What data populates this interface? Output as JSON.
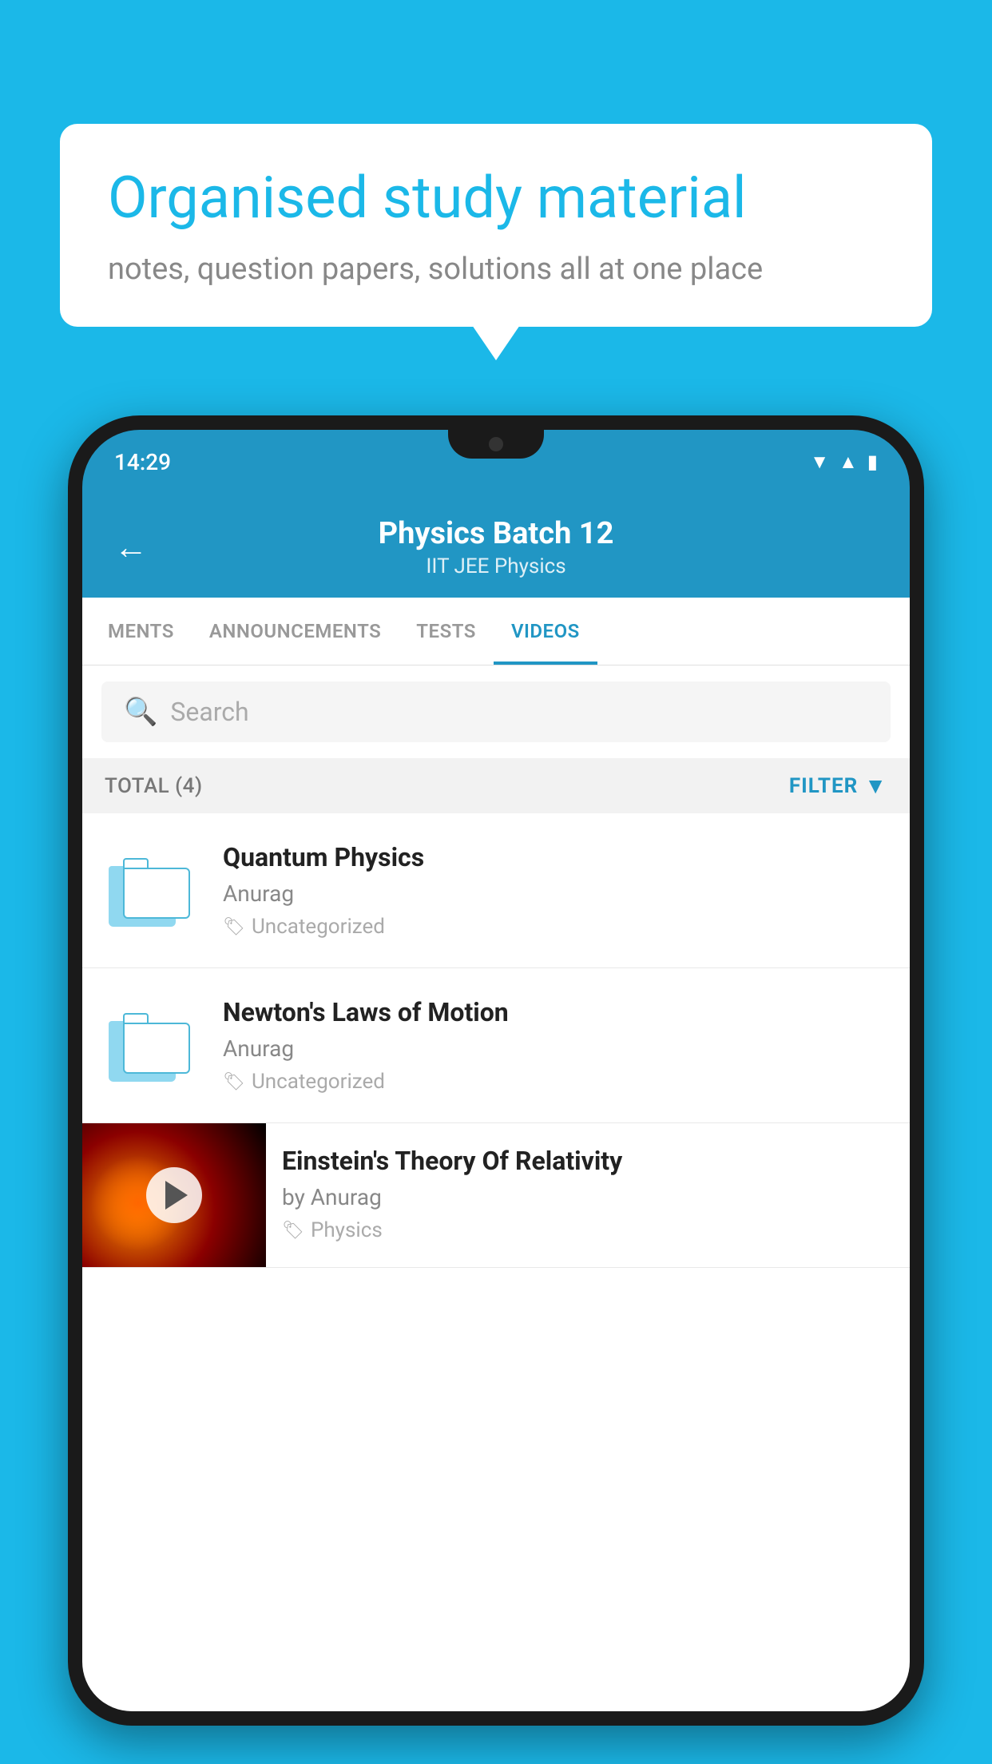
{
  "background_color": "#1bb8e8",
  "speech_bubble": {
    "title": "Organised study material",
    "subtitle": "notes, question papers, solutions all at one place"
  },
  "phone": {
    "status_bar": {
      "time": "14:29"
    },
    "header": {
      "back_label": "←",
      "title": "Physics Batch 12",
      "subtitle": "IIT JEE   Physics"
    },
    "tabs": [
      {
        "label": "MENTS",
        "active": false
      },
      {
        "label": "ANNOUNCEMENTS",
        "active": false
      },
      {
        "label": "TESTS",
        "active": false
      },
      {
        "label": "VIDEOS",
        "active": true
      }
    ],
    "search": {
      "placeholder": "Search"
    },
    "filter": {
      "total_label": "TOTAL (4)",
      "filter_label": "FILTER"
    },
    "videos": [
      {
        "title": "Quantum Physics",
        "author": "Anurag",
        "tag": "Uncategorized",
        "has_thumb": false
      },
      {
        "title": "Newton's Laws of Motion",
        "author": "Anurag",
        "tag": "Uncategorized",
        "has_thumb": false
      },
      {
        "title": "Einstein's Theory Of Relativity",
        "author": "by Anurag",
        "tag": "Physics",
        "has_thumb": true
      }
    ]
  }
}
